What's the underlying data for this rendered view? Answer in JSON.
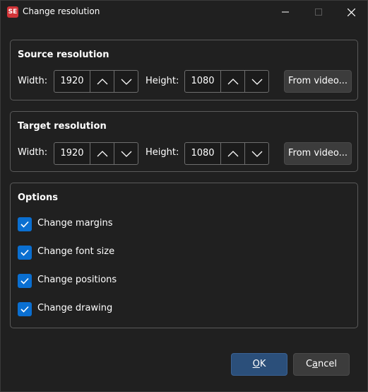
{
  "window": {
    "title": "Change resolution",
    "app_icon_text": "SE"
  },
  "source": {
    "title": "Source resolution",
    "width_label": "Width:",
    "width_value": "1920",
    "height_label": "Height:",
    "height_value": "1080",
    "from_video_label": "From video..."
  },
  "target": {
    "title": "Target resolution",
    "width_label": "Width:",
    "width_value": "1920",
    "height_label": "Height:",
    "height_value": "1080",
    "from_video_label": "From video..."
  },
  "options": {
    "title": "Options",
    "items": [
      {
        "label": "Change margins",
        "checked": true
      },
      {
        "label": "Change font size",
        "checked": true
      },
      {
        "label": "Change positions",
        "checked": true
      },
      {
        "label": "Change drawing",
        "checked": true
      }
    ]
  },
  "buttons": {
    "ok_mnemonic": "O",
    "ok_rest": "K",
    "cancel_first": "C",
    "cancel_mnemonic": "a",
    "cancel_rest": "ncel"
  },
  "colors": {
    "background": "#202020",
    "accent": "#0a6fd1",
    "primary_button": "#2b4f7a",
    "app_icon": "#d13438"
  }
}
